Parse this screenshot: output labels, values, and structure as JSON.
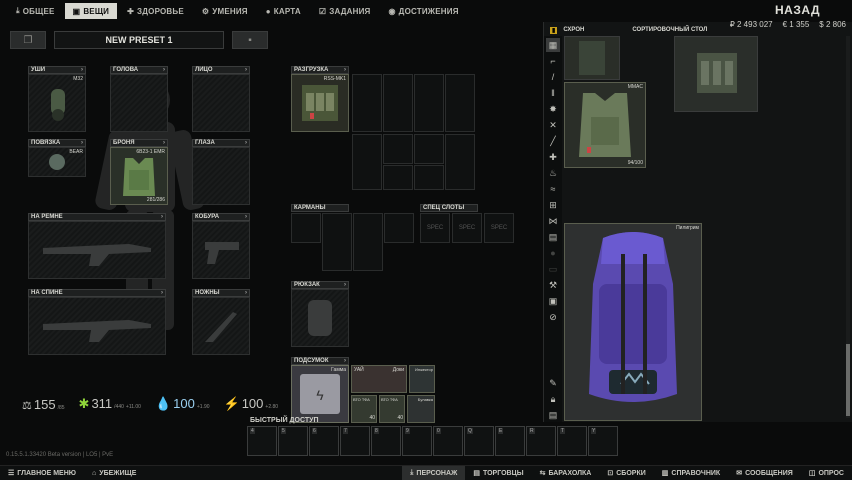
{
  "nav": {
    "tabs": [
      {
        "label": "ОБЩЕЕ",
        "icon": "download-icon"
      },
      {
        "label": "ВЕЩИ",
        "icon": "shirt-icon",
        "active": true
      },
      {
        "label": "ЗДОРОВЬЕ",
        "icon": "health-icon"
      },
      {
        "label": "УМЕНИЯ",
        "icon": "skills-icon"
      },
      {
        "label": "КАРТА",
        "icon": "map-pin-icon"
      },
      {
        "label": "ЗАДАНИЯ",
        "icon": "tasks-icon"
      },
      {
        "label": "ДОСТИЖЕНИЯ",
        "icon": "achievements-icon"
      }
    ],
    "back_label": "НАЗАД"
  },
  "preset": {
    "name": "NEW PRESET 1"
  },
  "equipment": {
    "earpiece": "УШИ",
    "earpiece_item": "M32",
    "head": "ГОЛОВА",
    "face": "ЛИЦО",
    "armband": "ПОВЯЗКА",
    "armband_item": "BEAR",
    "armor": "БРОНЯ",
    "armor_item": "6B23-1 EMR",
    "armor_durability": "281/286",
    "eyewear": "ГЛАЗА",
    "on_sling": "НА РЕМНЕ",
    "holster": "КОБУРА",
    "on_back": "НА СПИНЕ",
    "scabbard": "НОЖНЫ",
    "rig": "РАЗГРУЗКА",
    "rig_item": "RSS-MK1",
    "pockets": "КАРМАНЫ",
    "special_slots": "СПЕЦ СЛОТЫ",
    "spec_label": "SPEC",
    "backpack": "РЮКЗАК",
    "pouch": "ПОДСУМОК",
    "pouch_item": "Гамма",
    "pouch_contents": [
      {
        "label": "УАЙ"
      },
      {
        "label": "Доки"
      },
      {
        "label": "Инжектор"
      },
      {
        "label": "ВТО ТФА"
      },
      {
        "label": "ВТО ТФА"
      },
      {
        "label": "Булавка"
      }
    ],
    "pouch_counts": [
      "40",
      "40"
    ]
  },
  "stats": {
    "weight": "155",
    "weight_sub": "/85",
    "energy": "311",
    "energy_sub": "/440",
    "energy_rate": "+11.00",
    "hydration": "100",
    "hydration_rate": "+1.90",
    "stamina": "100",
    "stamina_rate": "+2.80"
  },
  "quick_access": {
    "label": "БЫСТРЫЙ ДОСТУП",
    "slots": [
      "4",
      "5",
      "6",
      "7",
      "8",
      "9",
      "0",
      "Q",
      "E",
      "R",
      "T",
      "Y",
      "U"
    ]
  },
  "stash": {
    "tabs": [
      {
        "label": "СХРОН",
        "icon": "lock-icon"
      },
      {
        "label": "СОРТИРОВОЧНЫЙ СТОЛ"
      }
    ],
    "currency": {
      "rub": "₽ 2 493 027",
      "eur": "€ 1 355",
      "usd": "$ 2 806"
    },
    "items": [
      {
        "label": "MMAC",
        "durability": "94/100"
      },
      {
        "label": "Пилигрим"
      }
    ],
    "sidebar_icons": [
      "grid-icon",
      "pistol-icon",
      "knife-icon",
      "ammo-icon",
      "gear-icon",
      "crossed-tools-icon",
      "stick-icon",
      "medical-icon",
      "flask-icon",
      "water-icon",
      "rig-icon",
      "armor-icon",
      "backpack-icon",
      "hand-icon",
      "battery-icon",
      "wrench-icon",
      "box-icon",
      "key-icon",
      "check-icon"
    ],
    "side_bottom_icons": [
      "pin-icon",
      "lock-icon",
      "sort-icon"
    ]
  },
  "version": "0.15.5.1.33420 Beta version | LO5  | PvE",
  "bottombar": {
    "left": [
      {
        "label": "ГЛАВНОЕ МЕНЮ",
        "icon": "menu-icon"
      },
      {
        "label": "УБЕЖИЩЕ",
        "icon": "hideout-icon"
      }
    ],
    "right": [
      {
        "label": "ПЕРСОНАЖ",
        "icon": "character-icon",
        "active": true
      },
      {
        "label": "ТОРГОВЦЫ",
        "icon": "traders-icon"
      },
      {
        "label": "БАРАХОЛКА",
        "icon": "flea-icon"
      },
      {
        "label": "СБОРКИ",
        "icon": "builds-icon"
      },
      {
        "label": "СПРАВОЧНИК",
        "icon": "handbook-icon"
      },
      {
        "label": "СООБЩЕНИЯ",
        "icon": "messages-icon"
      },
      {
        "label": "ОПРОС",
        "icon": "survey-icon"
      }
    ]
  }
}
